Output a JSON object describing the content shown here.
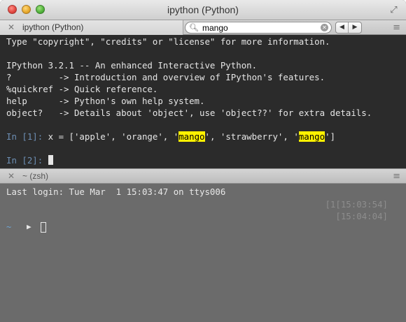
{
  "window": {
    "title": "ipython (Python)"
  },
  "tabs": [
    {
      "label": "ipython (Python)"
    }
  ],
  "find": {
    "value": "mango",
    "prev_icon": "triangle-left-icon",
    "next_icon": "triangle-right-icon"
  },
  "top_pane": {
    "lines": [
      "Type \"copyright\", \"credits\" or \"license\" for more information.",
      "",
      "IPython 3.2.1 -- An enhanced Interactive Python.",
      "?         -> Introduction and overview of IPython's features.",
      "%quickref -> Quick reference.",
      "help      -> Python's own help system.",
      "object?   -> Details about 'object', use 'object??' for extra details."
    ],
    "in1_prompt": "In [1]:",
    "in1_before": " x = ['apple', 'orange', '",
    "in1_match1": "mango",
    "in1_middle": "', 'strawberry', '",
    "in1_match2": "mango",
    "in1_after": "']",
    "in2_prompt": "In [2]:"
  },
  "split": {
    "label": "~ (zsh)"
  },
  "bottom_pane": {
    "last_login": "Last login: Tue Mar  1 15:03:47 on ttys006",
    "right_1": "[1[15:03:54]",
    "right_2": "[15:04:04]",
    "prompt_dir": "~",
    "prompt_arrow": "▶"
  },
  "colors": {
    "highlight": "#fff200",
    "prompt": "#6d8fb4",
    "top_bg": "#2b2b2b",
    "bottom_bg": "#6b6b6b"
  }
}
